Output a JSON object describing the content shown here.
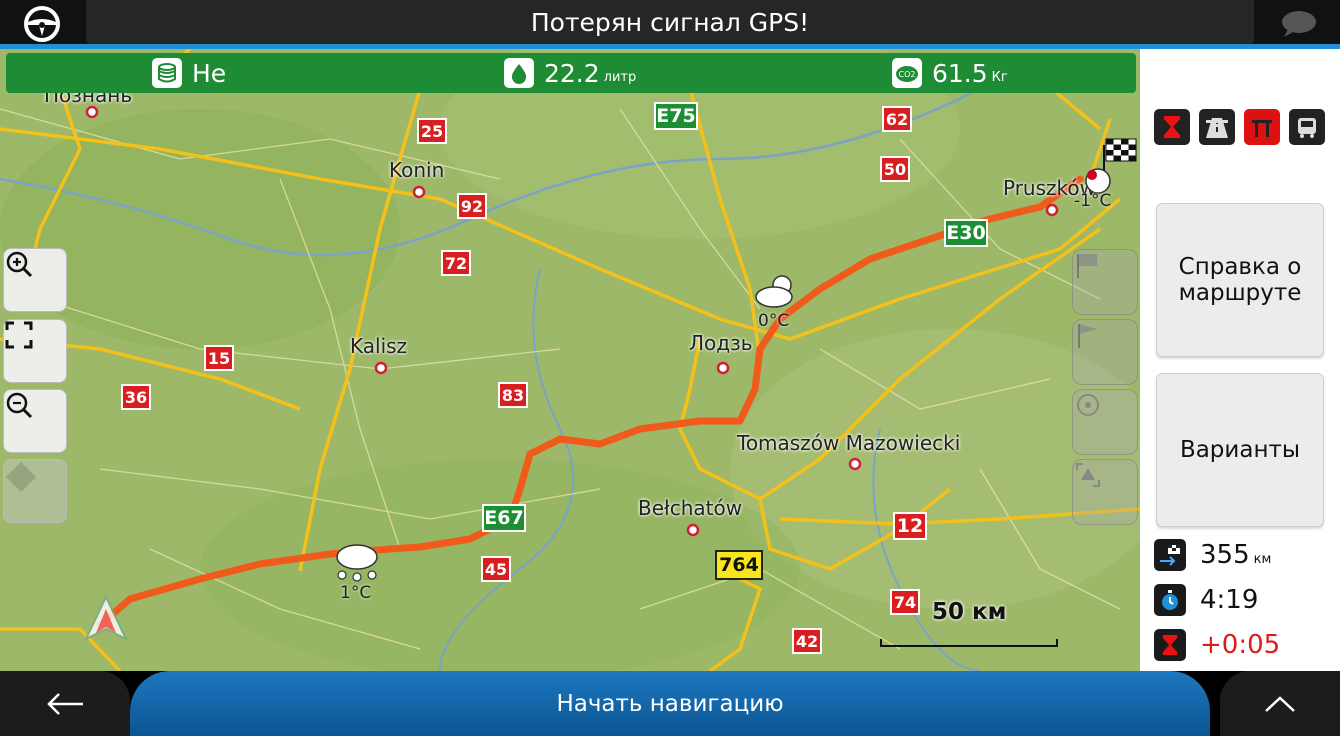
{
  "topbar": {
    "title": "Потерян сигнал GPS!"
  },
  "stats": {
    "toll": {
      "value": "Не",
      "icon": "coins-icon"
    },
    "fuel": {
      "value": "22.2",
      "unit": "литр",
      "icon": "fuel-drop-icon"
    },
    "co2": {
      "value": "61.5",
      "unit": "Кг",
      "icon": "co2-icon"
    }
  },
  "map": {
    "cities": [
      "Познань",
      "Konin",
      "Kalisz",
      "Лодзь",
      "Bełchatów",
      "Tomaszów Mazowiecki",
      "Pruszków"
    ],
    "road_shields": {
      "e75": "E75",
      "e30": "E30",
      "e67": "E67",
      "r25": "25",
      "r92": "92",
      "r72": "72",
      "r15": "15",
      "r36": "36",
      "r83": "83",
      "r45": "45",
      "r62": "62",
      "r50": "50",
      "r12": "12",
      "r74": "74",
      "r42": "42",
      "r764": "764"
    },
    "weather": {
      "lodz": "0°C",
      "start": "1°C",
      "dest": "-1°C"
    },
    "scale": "50 км"
  },
  "right_panel": {
    "route_info_button": "Справка о маршруте",
    "options_button": "Варианты",
    "distance": {
      "value": "355",
      "unit": "км"
    },
    "time": {
      "value": "4:19"
    },
    "delay": {
      "value": "+0:05"
    }
  },
  "bottom": {
    "start_label": "Начать навигацию"
  },
  "colors": {
    "route": "#f05a1a",
    "header_accent": "#1f8fd8",
    "stats_bg": "#1e8c35",
    "delay": "#e01b1b"
  }
}
